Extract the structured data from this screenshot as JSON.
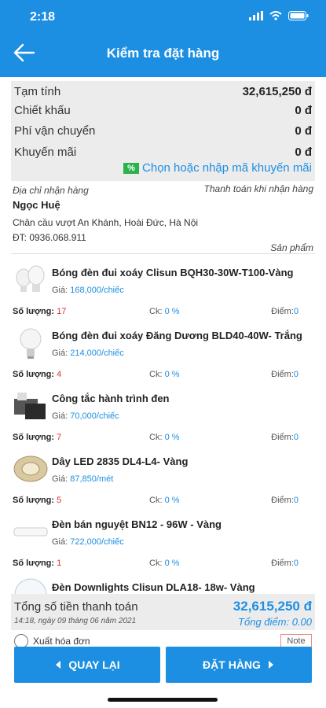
{
  "status": {
    "time": "2:18"
  },
  "header": {
    "title": "Kiểm tra đặt hàng"
  },
  "summary": {
    "rows": [
      {
        "label": "Tạm tính",
        "value": "32,615,250 đ"
      },
      {
        "label": "Chiết khấu",
        "value": "0 đ"
      },
      {
        "label": "Phí vận chuyển",
        "value": "0 đ"
      },
      {
        "label": "Khuyến mãi",
        "value": "0 đ"
      }
    ],
    "promo_link": "Chọn hoặc nhập mã khuyến mãi"
  },
  "delivery": {
    "address_label": "Địa chỉ nhận hàng",
    "payment_label": "Thanh toán khi nhận hàng",
    "name": "Ngọc Huệ",
    "address": "Chân cầu vượt An Khánh, Hoài Đức, Hà Nội",
    "phone": "ĐT: 0936.068.911",
    "products_label": "Sản phẩm"
  },
  "labels": {
    "price": "Giá:",
    "qty": "Số lượng:",
    "ck": "Ck:",
    "points": "Điểm:"
  },
  "items": [
    {
      "name": "Bóng đèn đui xoáy Clisun BQH30-30W-T100-Vàng",
      "price": "168,000/chiếc",
      "qty": "17",
      "ck": "0 %",
      "points": "0",
      "icon": "bulb-pair-icon"
    },
    {
      "name": "Bóng đèn đui xoáy Đăng Dương BLD40-40W- Trắng",
      "price": "214,000/chiếc",
      "qty": "4",
      "ck": "0 %",
      "points": "0",
      "icon": "bulb-icon"
    },
    {
      "name": "Công tắc hành trình đen",
      "price": "70,000/chiếc",
      "qty": "7",
      "ck": "0 %",
      "points": "0",
      "icon": "switch-icon"
    },
    {
      "name": "Dây LED 2835 DL4-L4- Vàng",
      "price": "87,850/mét",
      "qty": "5",
      "ck": "0 %",
      "points": "0",
      "icon": "led-strip-icon"
    },
    {
      "name": "Đèn bán nguyệt BN12 - 96W - Vàng",
      "price": "722,000/chiếc",
      "qty": "1",
      "ck": "0 %",
      "points": "0",
      "icon": "tube-light-icon"
    },
    {
      "name": "Đèn Downlights Clisun DLA18- 18w- Vàng",
      "price": "",
      "qty": "",
      "ck": "",
      "points": "",
      "icon": "downlight-icon"
    }
  ],
  "total": {
    "label": "Tổng số tiền thanh toán",
    "value": "32,615,250 đ",
    "date": "14:18, ngày 09 tháng 06 năm 2021",
    "points": "Tổng điểm: 0.00"
  },
  "invoice": {
    "label": "Xuất hóa đơn",
    "note": "Note"
  },
  "buttons": {
    "back": "QUAY LẠI",
    "order": "ĐẶT HÀNG"
  },
  "colors": {
    "primary": "#1d8fe2",
    "qty": "#e03030",
    "panel": "#ececec"
  }
}
